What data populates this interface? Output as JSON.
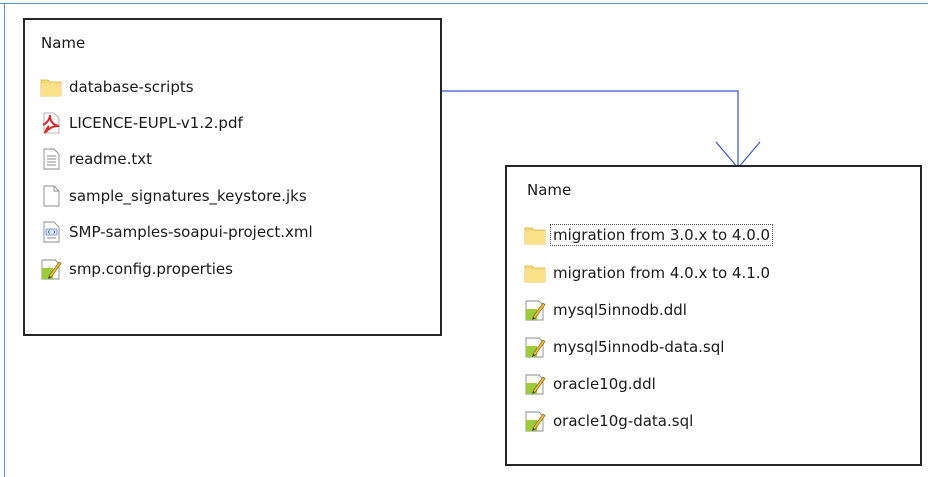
{
  "left_panel": {
    "header": "Name",
    "items": [
      {
        "label": "database-scripts",
        "icon": "folder-icon"
      },
      {
        "label": "LICENCE-EUPL-v1.2.pdf",
        "icon": "pdf-file-icon"
      },
      {
        "label": "readme.txt",
        "icon": "text-file-icon"
      },
      {
        "label": "sample_signatures_keystore.jks",
        "icon": "blank-file-icon"
      },
      {
        "label": "SMP-samples-soapui-project.xml",
        "icon": "xml-file-icon"
      },
      {
        "label": "smp.config.properties",
        "icon": "edit-file-icon"
      }
    ]
  },
  "right_panel": {
    "header": "Name",
    "items": [
      {
        "label": "migration from 3.0.x to 4.0.0",
        "icon": "folder-icon",
        "selected": true
      },
      {
        "label": "migration from 4.0.x to 4.1.0",
        "icon": "folder-icon"
      },
      {
        "label": "mysql5innodb.ddl",
        "icon": "edit-file-icon"
      },
      {
        "label": "mysql5innodb-data.sql",
        "icon": "edit-file-icon"
      },
      {
        "label": "oracle10g.ddl",
        "icon": "edit-file-icon"
      },
      {
        "label": "oracle10g-data.sql",
        "icon": "edit-file-icon"
      }
    ]
  },
  "colors": {
    "folder": "#f7d774",
    "connector": "#3a55c8",
    "frame": "#6b8fc7",
    "pdf": "#d62b2b"
  }
}
